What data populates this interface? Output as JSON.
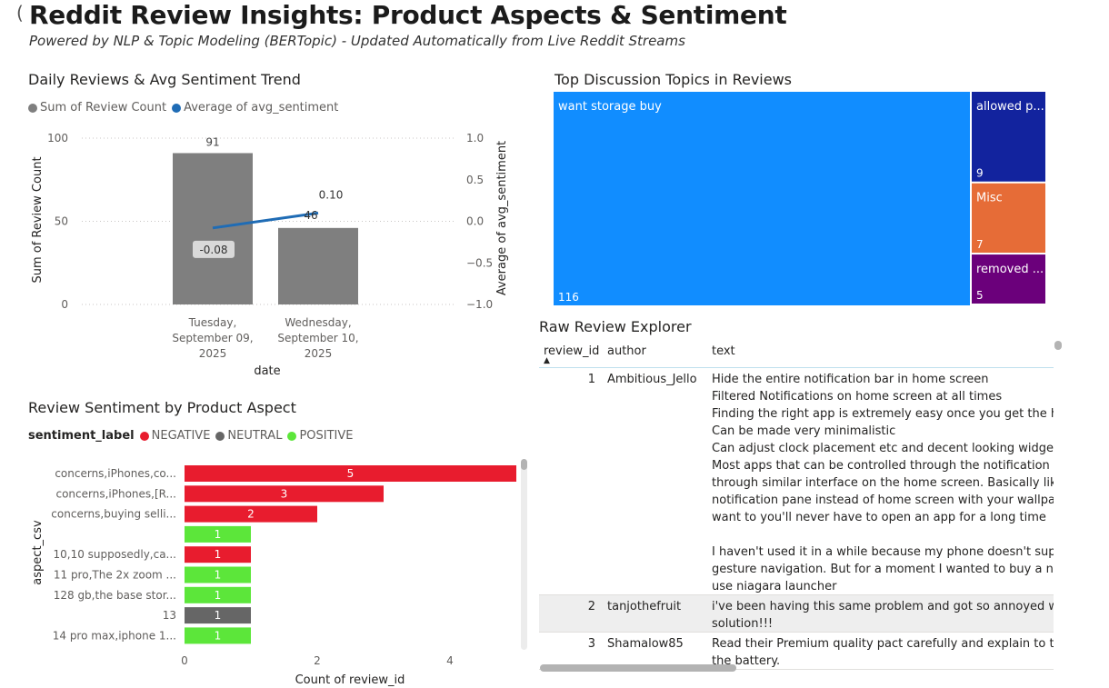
{
  "header": {
    "title": "Reddit Review Insights: Product Aspects & Sentiment",
    "subtitle": "Powered by NLP & Topic Modeling (BERTopic) - Updated Automatically from Live Reddit Streams"
  },
  "trend": {
    "title": "Daily Reviews & Avg Sentiment Trend",
    "legend": [
      {
        "label": "Sum of Review Count",
        "color": "#7f7f7f"
      },
      {
        "label": "Average of avg_sentiment",
        "color": "#1f6cb5"
      }
    ]
  },
  "treemap": {
    "title": "Top Discussion Topics in Reviews",
    "tiles": [
      {
        "label": "want storage buy",
        "value": "116",
        "color": "#118dff"
      },
      {
        "label": "allowed p...",
        "value": "9",
        "color": "#12239e"
      },
      {
        "label": "Misc",
        "value": "7",
        "color": "#e66c37"
      },
      {
        "label": "removed ...",
        "value": "5",
        "color": "#6b007b"
      }
    ]
  },
  "aspect": {
    "title": "Review Sentiment by Product Aspect",
    "legend_title": "sentiment_label",
    "legend": [
      {
        "label": "NEGATIVE",
        "color": "#e81c2e"
      },
      {
        "label": "NEUTRAL",
        "color": "#666666"
      },
      {
        "label": "POSITIVE",
        "color": "#5ce63a"
      }
    ]
  },
  "table": {
    "title": "Raw Review Explorer",
    "columns": [
      "review_id",
      "author",
      "text"
    ],
    "sort_icon": "sort-ascending-icon",
    "rows": [
      {
        "id": "1",
        "author": "Ambitious_Jello",
        "lines": [
          "Hide the entire notification bar in home screen",
          "Filtered Notifications on home screen at all times",
          "Finding the right app is extremely easy once you get the har",
          "Can be made very minimalistic",
          "Can adjust clock placement etc and decent looking widgets",
          "Most apps that can be controlled through the notification p",
          "through similar interface on the home screen. Basically like a",
          "notification pane instead of home screen with your wallpape",
          "want to you'll never have to open an app for a long time",
          "",
          "I haven't used it in a while because my phone doesn't suppo",
          "gesture navigation. But for a moment I wanted to buy a new",
          "use niagara launcher"
        ]
      },
      {
        "id": "2",
        "author": "tanjothefruit",
        "lines": [
          "i've been having this same problem and got so annoyed wit",
          "solution!!!"
        ]
      },
      {
        "id": "3",
        "author": "Shamalow85",
        "lines": [
          "Read their Premium quality pact carefully and explain to the",
          "the battery."
        ]
      }
    ]
  },
  "chart_data": [
    {
      "type": "bar",
      "title": "Daily Reviews & Avg Sentiment Trend",
      "categories": [
        "Tuesday, September 09, 2025",
        "Wednesday, September 10, 2025"
      ],
      "category_lines": [
        [
          "Tuesday,",
          "September 09,",
          "2025"
        ],
        [
          "Wednesday,",
          "September 10,",
          "2025"
        ]
      ],
      "series": [
        {
          "name": "Sum of Review Count",
          "type": "bar",
          "axis": "left",
          "values": [
            91,
            46
          ],
          "labels": [
            "91",
            "46"
          ],
          "color": "#7f7f7f"
        },
        {
          "name": "Average of avg_sentiment",
          "type": "line",
          "axis": "right",
          "values": [
            -0.08,
            0.1
          ],
          "labels": [
            "-0.08",
            "0.10"
          ],
          "color": "#1f6cb5"
        }
      ],
      "xlabel": "date",
      "ylabel": "Sum of Review Count",
      "y2label": "Average of avg_sentiment",
      "ylim": [
        0,
        100
      ],
      "yticks": [
        0,
        50,
        100
      ],
      "y2lim": [
        -1.0,
        1.0
      ],
      "y2ticks": [
        "1.0",
        "0.5",
        "0.0",
        "−0.5",
        "−1.0"
      ],
      "y2tick_values": [
        1.0,
        0.5,
        0.0,
        -0.5,
        -1.0
      ],
      "grid": true,
      "legend": "top-left"
    },
    {
      "type": "bar",
      "orientation": "horizontal",
      "title": "Review Sentiment by Product Aspect",
      "categories": [
        "concerns,iPhones,co...",
        "concerns,iPhones,[R...",
        "concerns,buying selli...",
        "",
        "10,10 supposedly,ca...",
        "11 pro,The 2x zoom ...",
        "128 gb,the base stor...",
        "13",
        "14 pro max,iphone 1..."
      ],
      "values": [
        5,
        3,
        2,
        1,
        1,
        1,
        1,
        1,
        1
      ],
      "sentiment": [
        "NEGATIVE",
        "NEGATIVE",
        "NEGATIVE",
        "POSITIVE",
        "NEGATIVE",
        "POSITIVE",
        "POSITIVE",
        "NEUTRAL",
        "POSITIVE"
      ],
      "xlabel": "Count of review_id",
      "ylabel": "aspect_csv",
      "xlim": [
        0,
        5
      ],
      "xticks": [
        0,
        2,
        4
      ],
      "legend": "top-left"
    },
    {
      "type": "treemap",
      "title": "Top Discussion Topics in Reviews",
      "categories": [
        "want storage buy",
        "allowed p...",
        "Misc",
        "removed ..."
      ],
      "values": [
        116,
        9,
        7,
        5
      ]
    }
  ]
}
